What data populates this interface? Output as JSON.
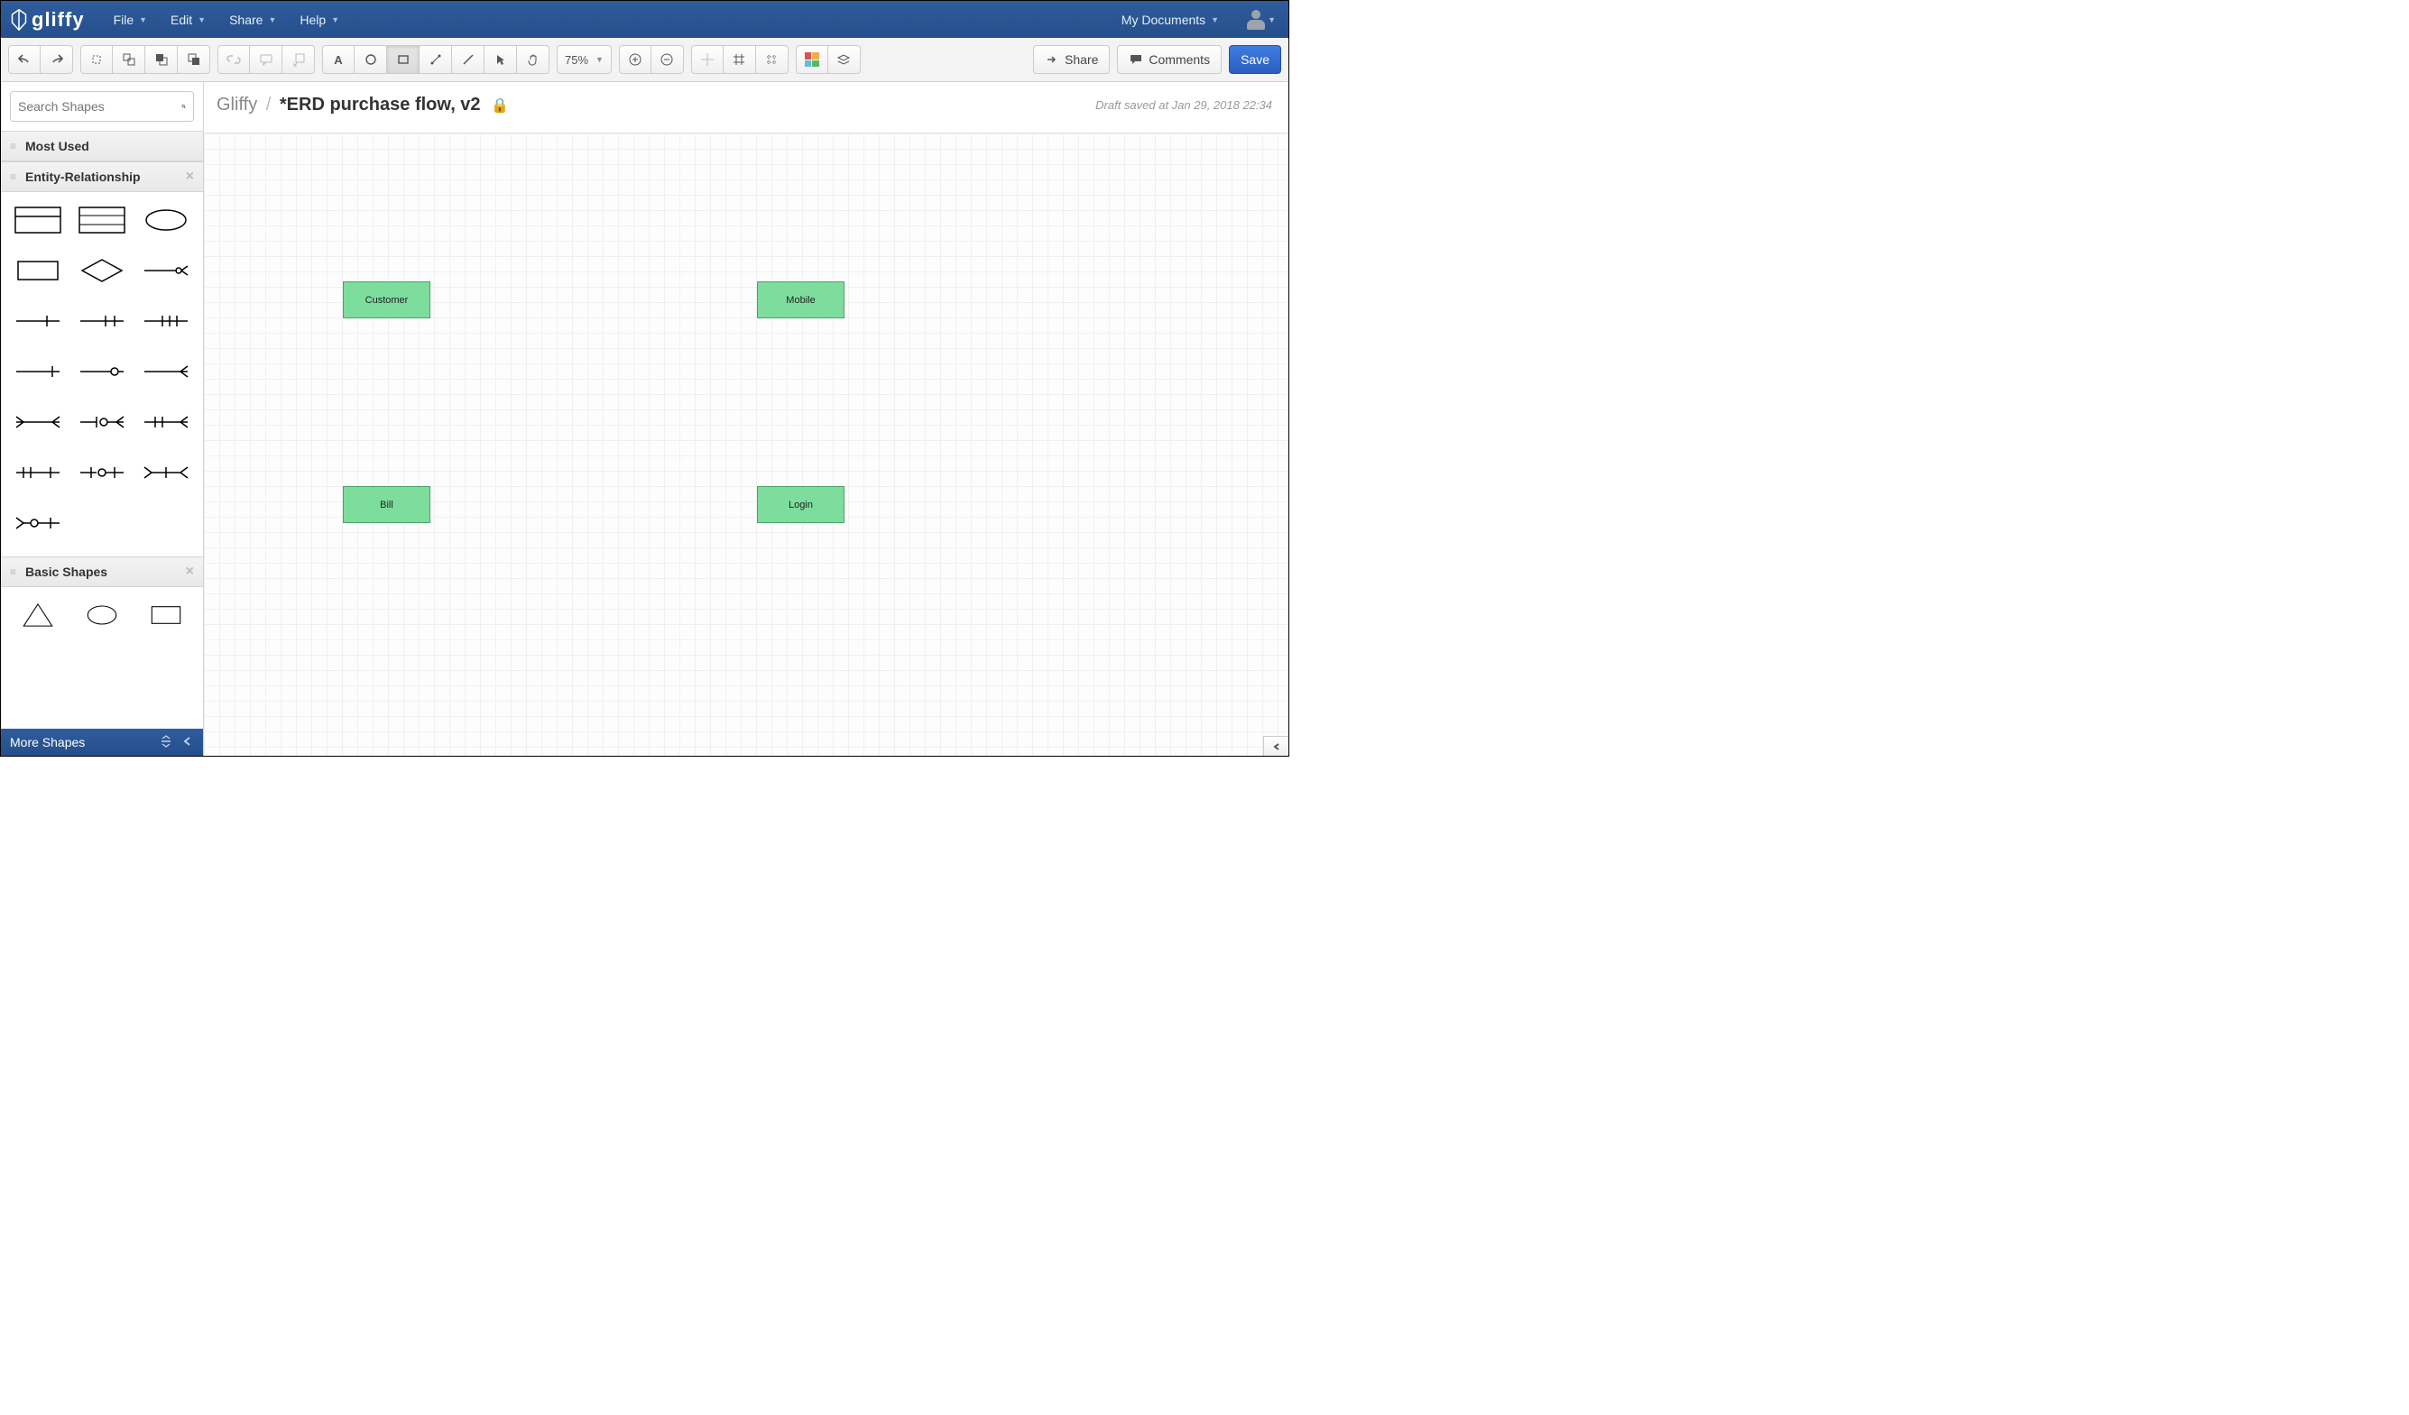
{
  "app": {
    "name": "gliffy"
  },
  "topMenus": [
    "File",
    "Edit",
    "Share",
    "Help"
  ],
  "myDocs": "My Documents",
  "toolbar": {
    "zoom": "75%",
    "share": "Share",
    "comments": "Comments",
    "save": "Save"
  },
  "search": {
    "placeholder": "Search Shapes"
  },
  "libraries": {
    "mostUsed": "Most Used",
    "er": "Entity-Relationship",
    "basic": "Basic Shapes"
  },
  "footer": {
    "more": "More Shapes"
  },
  "breadcrumb": {
    "root": "Gliffy",
    "title": "*ERD purchase flow, v2"
  },
  "status": "Draft saved at Jan 29, 2018 22:34",
  "nodes": {
    "customer": "Customer",
    "mobile": "Mobile",
    "bill": "Bill",
    "login": "Login"
  }
}
